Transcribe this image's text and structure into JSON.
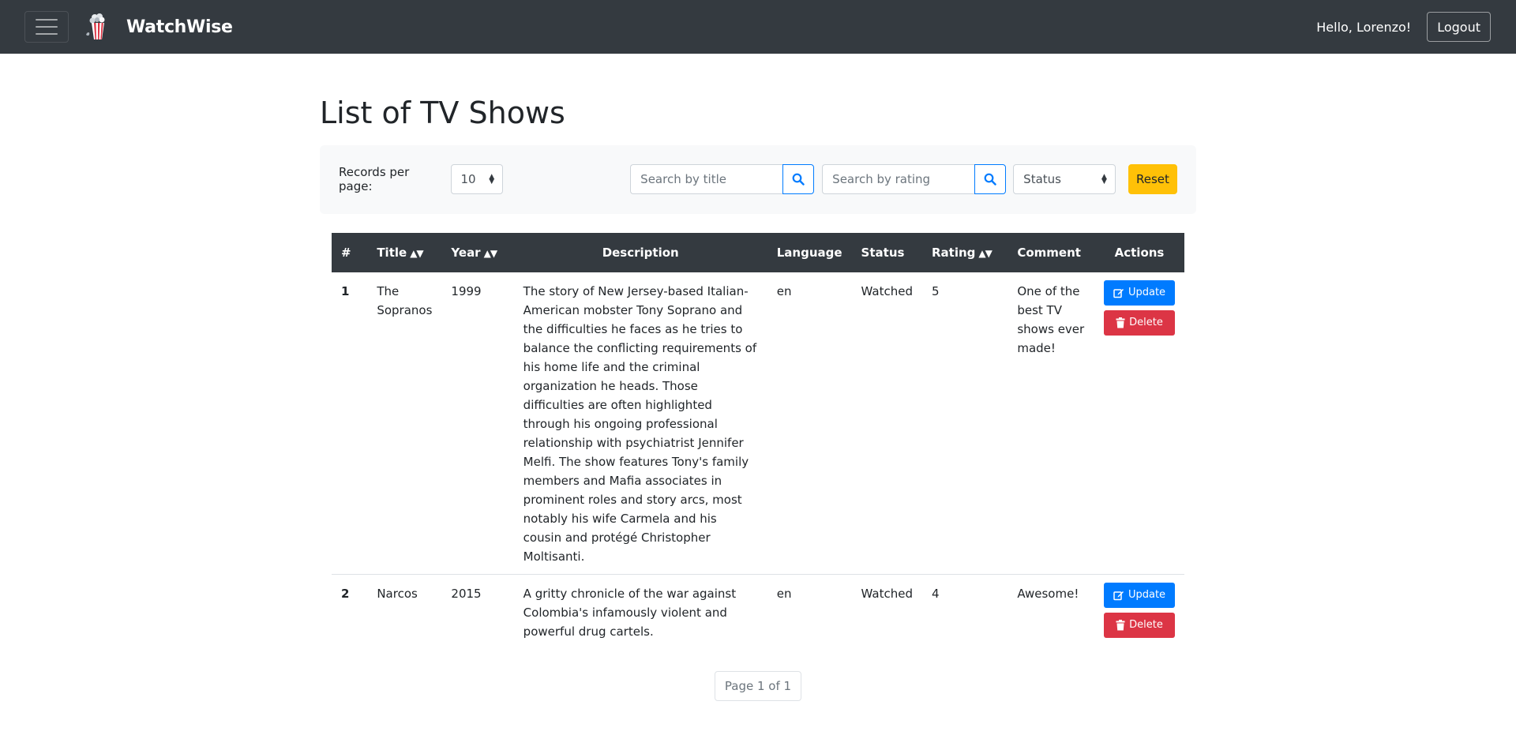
{
  "navbar": {
    "brand_name": "WatchWise",
    "greeting": "Hello, Lorenzo!",
    "logout_label": "Logout"
  },
  "page": {
    "title": "List of TV Shows"
  },
  "filters": {
    "records_per_page_label": "Records per page:",
    "records_per_page_value": "10",
    "title_search_placeholder": "Search by title",
    "rating_search_placeholder": "Search by rating",
    "status_value": "Status",
    "reset_label": "Reset"
  },
  "table": {
    "columns": [
      "#",
      "Title",
      "Year",
      "Description",
      "Language",
      "Status",
      "Rating",
      "Comment",
      "Actions"
    ],
    "sort_indicator": "▲▼",
    "rows": [
      {
        "num": "1",
        "title": "The Sopranos",
        "year": "1999",
        "description": "The story of New Jersey-based Italian-American mobster Tony Soprano and the difficulties he faces as he tries to balance the conflicting requirements of his home life and the criminal organization he heads. Those difficulties are often highlighted through his ongoing professional relationship with psychiatrist Jennifer Melfi. The show features Tony's family members and Mafia associates in prominent roles and story arcs, most notably his wife Carmela and his cousin and protégé Christopher Moltisanti.",
        "language": "en",
        "status": "Watched",
        "rating": "5",
        "comment": "One of the best TV shows ever made!",
        "update_label": "Update",
        "delete_label": "Delete"
      },
      {
        "num": "2",
        "title": "Narcos",
        "year": "2015",
        "description": "A gritty chronicle of the war against Colombia's infamously violent and powerful drug cartels.",
        "language": "en",
        "status": "Watched",
        "rating": "4",
        "comment": "Awesome!",
        "update_label": "Update",
        "delete_label": "Delete"
      }
    ]
  },
  "pagination": {
    "label": "Page 1 of 1"
  },
  "colors": {
    "navbar_bg": "#343a40",
    "primary": "#007bff",
    "danger": "#dc3545",
    "warning": "#ffc107"
  },
  "icons": {
    "menu": "hamburger-icon",
    "logo": "popcorn-logo-icon",
    "search": "search-icon",
    "update": "edit-icon",
    "delete": "trash-icon"
  }
}
